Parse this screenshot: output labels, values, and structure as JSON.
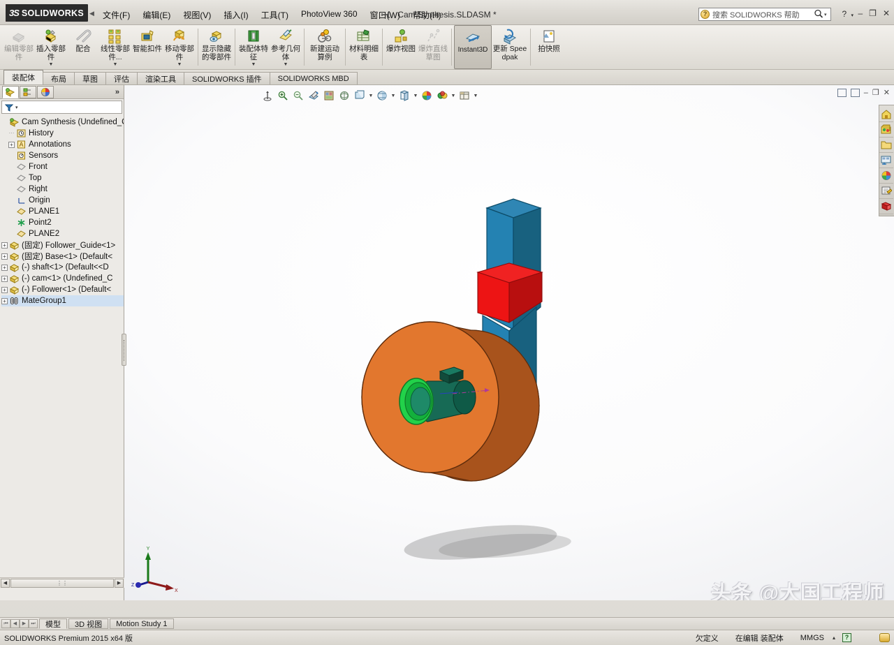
{
  "app": {
    "brand_ds": "3S",
    "brand_name": "SOLIDWORKS",
    "document_title": "Cam Synthesis.SLDASM *",
    "accent_red": "#c8102e",
    "product_footer": "SOLIDWORKS Premium 2015 x64 版"
  },
  "menubar": {
    "collapse_arrow": "◀",
    "items": [
      {
        "label": "文件(F)"
      },
      {
        "label": "编辑(E)"
      },
      {
        "label": "视图(V)"
      },
      {
        "label": "插入(I)"
      },
      {
        "label": "工具(T)"
      },
      {
        "label": "PhotoView 360"
      },
      {
        "label": "窗口(W)"
      },
      {
        "label": "帮助(H)"
      }
    ],
    "pin_icon": "pushpin-icon"
  },
  "search": {
    "placeholder": "搜索 SOLIDWORKS 帮助",
    "value": "",
    "icon": "help-search-icon",
    "magnifier": "⌕",
    "caret": "▾"
  },
  "window_controls": {
    "help_glyph": "?",
    "help_caret": "▾",
    "minimize": "–",
    "restore": "❐",
    "close": "✕"
  },
  "ribbon": {
    "buttons": [
      {
        "id": "edit-component",
        "label": "编辑零部件",
        "icon": "edit-component-icon",
        "dropdown": false,
        "disabled": true,
        "active": false
      },
      {
        "id": "insert-components",
        "label": "插入零部件",
        "icon": "insert-component-icon",
        "dropdown": true,
        "disabled": false,
        "active": false
      },
      {
        "id": "mate",
        "label": "配合",
        "icon": "mate-icon",
        "dropdown": false,
        "disabled": false,
        "active": false
      },
      {
        "id": "linear-pattern",
        "label": "线性零部件...",
        "icon": "linear-pattern-icon",
        "dropdown": true,
        "disabled": false,
        "active": false
      },
      {
        "id": "smart-fasteners",
        "label": "智能扣件",
        "icon": "smart-fastener-icon",
        "dropdown": false,
        "disabled": false,
        "active": false
      },
      {
        "id": "move-component",
        "label": "移动零部件",
        "icon": "move-component-icon",
        "dropdown": true,
        "disabled": false,
        "active": false
      },
      {
        "id": "show-hidden",
        "label": "显示隐藏的零部件",
        "icon": "show-hidden-icon",
        "dropdown": false,
        "disabled": false,
        "active": false
      },
      {
        "id": "assembly-features",
        "label": "装配体特征",
        "icon": "assembly-feature-icon",
        "dropdown": true,
        "disabled": false,
        "active": false
      },
      {
        "id": "reference-geometry",
        "label": "参考几何体",
        "icon": "reference-geometry-icon",
        "dropdown": true,
        "disabled": false,
        "active": false
      },
      {
        "id": "new-motion-study",
        "label": "新建运动算例",
        "icon": "motion-study-icon",
        "dropdown": false,
        "disabled": false,
        "active": false
      },
      {
        "id": "bill-of-materials",
        "label": "材料明细表",
        "icon": "bom-icon",
        "dropdown": false,
        "disabled": false,
        "active": false
      },
      {
        "id": "exploded-view",
        "label": "爆炸视图",
        "icon": "exploded-view-icon",
        "dropdown": false,
        "disabled": false,
        "active": false
      },
      {
        "id": "explode-line",
        "label": "爆炸直线草图",
        "icon": "explode-line-icon",
        "dropdown": false,
        "disabled": true,
        "active": false
      },
      {
        "id": "instant3d",
        "label": "Instant3D",
        "icon": "instant3d-icon",
        "dropdown": false,
        "disabled": false,
        "active": true
      },
      {
        "id": "update-speedpak",
        "label": "更新 Speedpak",
        "icon": "speedpak-icon",
        "dropdown": false,
        "disabled": false,
        "active": false
      },
      {
        "id": "take-snapshot",
        "label": "拍快照",
        "icon": "snapshot-icon",
        "dropdown": false,
        "disabled": false,
        "active": false
      }
    ],
    "separators_after": [
      "move-component",
      "show-hidden",
      "reference-geometry",
      "new-motion-study",
      "bill-of-materials",
      "explode-line",
      "instant3d",
      "update-speedpak"
    ]
  },
  "command_tabs": [
    {
      "label": "装配体",
      "active": true
    },
    {
      "label": "布局",
      "active": false
    },
    {
      "label": "草图",
      "active": false
    },
    {
      "label": "评估",
      "active": false
    },
    {
      "label": "渲染工具",
      "active": false
    },
    {
      "label": "SOLIDWORKS 插件",
      "active": false
    },
    {
      "label": "SOLIDWORKS MBD",
      "active": false
    }
  ],
  "left_panel": {
    "tabs": [
      {
        "id": "feature-manager",
        "icon": "feature-tree-icon",
        "active": true
      },
      {
        "id": "property-manager",
        "icon": "property-manager-icon",
        "active": false
      },
      {
        "id": "display-manager",
        "icon": "display-manager-icon",
        "active": false
      }
    ],
    "chevron": "»",
    "filter": {
      "icon": "filter-icon",
      "caret": "▾",
      "placeholder": ""
    },
    "tree": [
      {
        "label": "Cam Synthesis  (Undefined_C",
        "icon": "assembly-icon",
        "indent": 0,
        "expander": "none"
      },
      {
        "label": "History",
        "icon": "history-icon",
        "indent": 1,
        "expander": "none"
      },
      {
        "label": "Annotations",
        "icon": "annotations-icon",
        "indent": 1,
        "expander": "+"
      },
      {
        "label": "Sensors",
        "icon": "sensors-icon",
        "indent": 1,
        "expander": "none"
      },
      {
        "label": "Front",
        "icon": "plane-icon",
        "indent": 1,
        "expander": "none"
      },
      {
        "label": "Top",
        "icon": "plane-icon",
        "indent": 1,
        "expander": "none"
      },
      {
        "label": "Right",
        "icon": "plane-icon",
        "indent": 1,
        "expander": "none"
      },
      {
        "label": "Origin",
        "icon": "origin-icon",
        "indent": 1,
        "expander": "none"
      },
      {
        "label": "PLANE1",
        "icon": "plane-gold-icon",
        "indent": 1,
        "expander": "none"
      },
      {
        "label": "Point2",
        "icon": "point-icon",
        "indent": 1,
        "expander": "none"
      },
      {
        "label": "PLANE2",
        "icon": "plane-gold-icon",
        "indent": 1,
        "expander": "none"
      },
      {
        "label": "(固定) Follower_Guide<1>",
        "icon": "part-icon",
        "indent": 0,
        "expander": "+"
      },
      {
        "label": "(固定) Base<1> (Default<",
        "icon": "part-icon",
        "indent": 0,
        "expander": "+"
      },
      {
        "label": "(-) shaft<1> (Default<<D",
        "icon": "part-icon",
        "indent": 0,
        "expander": "+"
      },
      {
        "label": "(-) cam<1> (Undefined_C",
        "icon": "part-icon",
        "indent": 0,
        "expander": "+"
      },
      {
        "label": "(-) Follower<1> (Default<",
        "icon": "part-icon",
        "indent": 0,
        "expander": "+"
      },
      {
        "label": "MateGroup1",
        "icon": "mategroup-icon",
        "indent": 0,
        "expander": "+"
      }
    ],
    "hscroll": {
      "left_arrow": "◀",
      "right_arrow": "▶",
      "thumb_glyph": "⋮⋮"
    }
  },
  "view_toolbar": [
    {
      "id": "zoom-to-fit",
      "icon": "zoom-to-fit-icon",
      "caret": false
    },
    {
      "id": "zoom-to-area",
      "icon": "zoom-area-icon",
      "caret": false
    },
    {
      "id": "previous-view",
      "icon": "previous-view-icon",
      "caret": false
    },
    {
      "id": "section-view",
      "icon": "section-view-icon",
      "caret": false
    },
    {
      "id": "view-orientation",
      "icon": "view-orientation-icon",
      "caret": false
    },
    {
      "id": "3d-drawing-view",
      "icon": "3d-drawing-view-icon",
      "caret": false
    },
    {
      "id": "display-style",
      "icon": "display-style-icon",
      "caret": true
    },
    {
      "id": "hide-show-items",
      "icon": "hide-show-items-icon",
      "caret": true
    },
    {
      "id": "edit-appearance",
      "icon": "edit-appearance-icon",
      "caret": true
    },
    {
      "id": "apply-scene",
      "icon": "apply-scene-icon",
      "caret": false
    },
    {
      "id": "view-settings",
      "icon": "view-settings-icon",
      "caret": true
    },
    {
      "id": "viewport",
      "icon": "viewport-icon",
      "caret": true
    }
  ],
  "graphics_window_controls": {
    "restore_doc": "⧉",
    "maximize_doc": "▣",
    "minimize": "–",
    "restore": "❐",
    "close": "✕"
  },
  "task_pane": [
    {
      "id": "sw-resources",
      "icon": "home-icon"
    },
    {
      "id": "design-library",
      "icon": "design-library-icon"
    },
    {
      "id": "file-explorer",
      "icon": "folder-icon"
    },
    {
      "id": "view-palette",
      "icon": "view-palette-icon"
    },
    {
      "id": "appearances-scenes",
      "icon": "appearances-icon"
    },
    {
      "id": "custom-properties",
      "icon": "custom-properties-icon"
    },
    {
      "id": "solidworks-forum",
      "icon": "forum-icon"
    }
  ],
  "model": {
    "follower_color": "#1f7fb0",
    "follower_dark": "#12556f",
    "collar_color": "#e11818",
    "collar_dark": "#9e0d0d",
    "cam_color": "#e2772e",
    "cam_dark": "#9b4a18",
    "shaft_color": "#1fa84a",
    "shaft_dark": "#10603f",
    "triad": {
      "x_label": "X",
      "y_label": "Y",
      "z_label": "Z",
      "x_color": "#8b1a1a",
      "y_color": "#1a6b1a",
      "z_color": "#1a1a8b"
    }
  },
  "watermark": "头条 @大国工程师",
  "bottom_tabs": {
    "nav": [
      "⏮",
      "◀",
      "▶",
      "⏭"
    ],
    "items": [
      {
        "label": "模型",
        "active": true
      },
      {
        "label": "3D 视图",
        "active": false
      },
      {
        "label": "Motion Study 1",
        "active": false
      }
    ]
  },
  "status_bar": {
    "left": "SOLIDWORKS Premium 2015 x64 版",
    "state": "欠定义",
    "mode": "在编辑 装配体",
    "units": "MMGS",
    "units_caret": "▴",
    "question_icon": "help-status-icon",
    "badge_icon": "overlay-badge-icon"
  }
}
